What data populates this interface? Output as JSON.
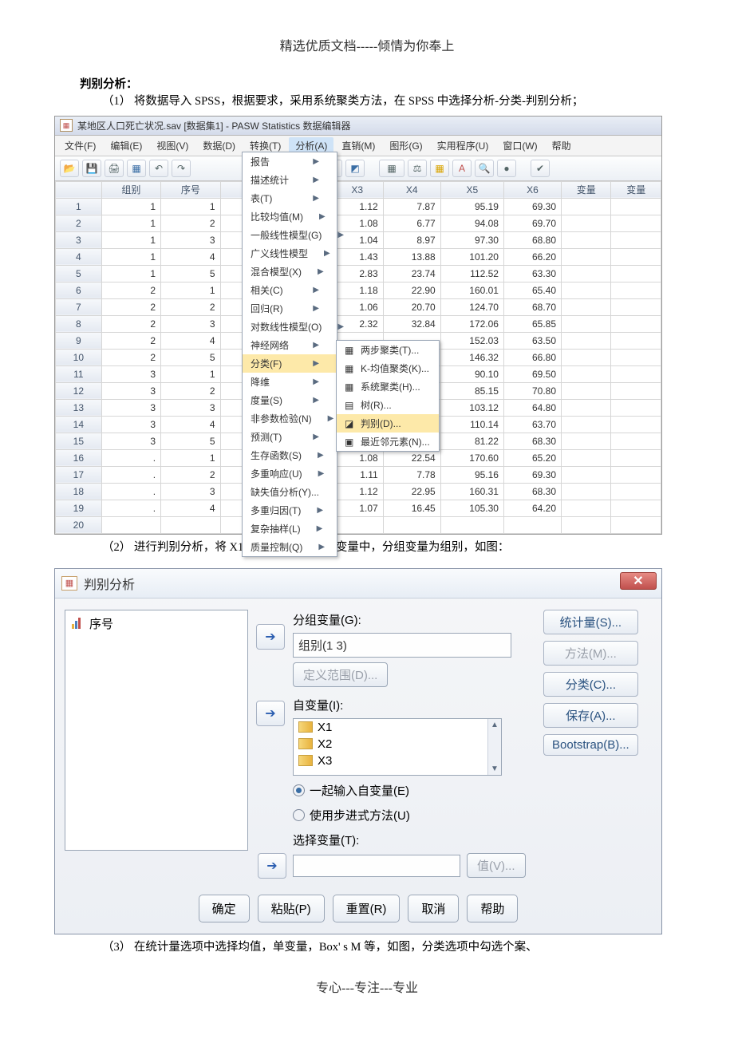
{
  "page_header": "精选优质文档-----倾情为你奉上",
  "page_footer": "专心---专注---专业",
  "heading": "判别分析：",
  "steps": {
    "s1": "（1） 将数据导入 SPSS，根据要求，采用系统聚类方法，在 SPSS 中选择分析-分类-判别分析；",
    "s2": "（2） 进行判别分析，将 X1 到 X6 全部选入自变量中，分组变量为组别，如图：",
    "s3": "（3） 在统计量选项中选择均值，单变量，Box' s M 等，如图，分类选项中勾选个案、"
  },
  "spss": {
    "title": "某地区人口死亡状况.sav [数据集1] - PASW Statistics 数据编辑器",
    "menus": [
      "文件(F)",
      "编辑(E)",
      "视图(V)",
      "数据(D)",
      "转换(T)",
      "分析(A)",
      "直销(M)",
      "图形(G)",
      "实用程序(U)",
      "窗口(W)",
      "帮助"
    ],
    "cols": [
      "",
      "组别",
      "序号",
      "",
      "X3",
      "X4",
      "X5",
      "X6",
      "变量",
      "变量"
    ],
    "rows": [
      [
        1,
        1,
        1,
        "",
        1.12,
        7.87,
        95.19,
        69.3
      ],
      [
        2,
        1,
        2,
        "",
        1.08,
        6.77,
        94.08,
        69.7
      ],
      [
        3,
        1,
        3,
        "",
        1.04,
        8.97,
        97.3,
        68.8
      ],
      [
        4,
        1,
        4,
        "",
        1.43,
        13.88,
        101.2,
        66.2
      ],
      [
        5,
        1,
        5,
        "",
        2.83,
        23.74,
        112.52,
        63.3
      ],
      [
        6,
        2,
        1,
        "",
        1.18,
        22.9,
        160.01,
        65.4
      ],
      [
        7,
        2,
        2,
        "",
        1.06,
        20.7,
        124.7,
        68.7
      ],
      [
        8,
        2,
        3,
        "",
        2.32,
        32.84,
        172.06,
        65.85
      ],
      [
        9,
        2,
        4,
        "",
        "",
        "",
        152.03,
        63.5
      ],
      [
        10,
        2,
        5,
        "",
        "",
        "",
        146.32,
        66.8
      ],
      [
        11,
        3,
        1,
        "",
        "",
        "",
        90.1,
        69.5
      ],
      [
        12,
        3,
        2,
        "",
        "",
        "",
        85.15,
        70.8
      ],
      [
        13,
        3,
        3,
        "",
        "",
        "",
        103.12,
        64.8
      ],
      [
        14,
        3,
        4,
        "",
        "",
        "",
        110.14,
        63.7
      ],
      [
        15,
        3,
        5,
        "",
        "",
        "",
        81.22,
        68.3
      ],
      [
        16,
        ".",
        1,
        "",
        1.08,
        22.54,
        170.6,
        65.2
      ],
      [
        17,
        ".",
        2,
        "",
        1.11,
        7.78,
        95.16,
        69.3
      ],
      [
        18,
        ".",
        3,
        "",
        1.12,
        22.95,
        160.31,
        68.3
      ],
      [
        19,
        ".",
        4,
        "",
        1.07,
        16.45,
        105.3,
        64.2
      ],
      [
        20,
        "",
        "",
        "",
        "",
        "",
        "",
        ""
      ]
    ],
    "analysis_menu": [
      "报告",
      "描述统计",
      "表(T)",
      "比较均值(M)",
      "一般线性模型(G)",
      "广义线性模型",
      "混合模型(X)",
      "相关(C)",
      "回归(R)",
      "对数线性模型(O)",
      "神经网络",
      "分类(F)",
      "降维",
      "度量(S)",
      "非参数检验(N)",
      "预测(T)",
      "生存函数(S)",
      "多重响应(U)",
      "缺失值分析(Y)...",
      "多重归因(T)",
      "复杂抽样(L)",
      "质量控制(Q)"
    ],
    "classify_submenu": [
      "两步聚类(T)...",
      "K-均值聚类(K)...",
      "系统聚类(H)...",
      "树(R)...",
      "判别(D)...",
      "最近邻元素(N)..."
    ]
  },
  "dlg": {
    "title": "判别分析",
    "left_items": [
      "序号"
    ],
    "group_label": "分组变量(G):",
    "group_value": "组别(1 3)",
    "define_range": "定义范围(D)...",
    "iv_label": "自变量(I):",
    "iv_items": [
      "X1",
      "X2",
      "X3"
    ],
    "radio_enter": "一起输入自变量(E)",
    "radio_step": "使用步进式方法(U)",
    "select_label": "选择变量(T):",
    "value_btn": "值(V)...",
    "side": [
      "统计量(S)...",
      "方法(M)...",
      "分类(C)...",
      "保存(A)...",
      "Bootstrap(B)..."
    ],
    "foot": [
      "确定",
      "粘贴(P)",
      "重置(R)",
      "取消",
      "帮助"
    ]
  }
}
